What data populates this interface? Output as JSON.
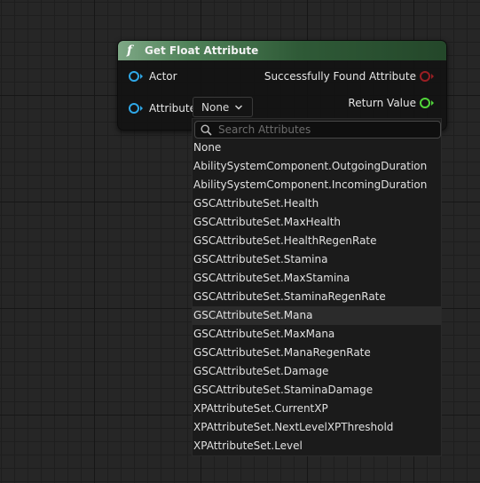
{
  "node": {
    "title": "Get Float Attribute",
    "icon": "function-icon",
    "inputs": {
      "actor_label": "Actor",
      "attribute_label": "Attribute",
      "attribute_value": "None"
    },
    "outputs": {
      "found_label": "Successfully Found Attribute",
      "return_label": "Return Value"
    }
  },
  "dropdown": {
    "search_placeholder": "Search Attributes",
    "search_value": "",
    "options": [
      "None",
      "AbilitySystemComponent.OutgoingDuration",
      "AbilitySystemComponent.IncomingDuration",
      "GSCAttributeSet.Health",
      "GSCAttributeSet.MaxHealth",
      "GSCAttributeSet.HealthRegenRate",
      "GSCAttributeSet.Stamina",
      "GSCAttributeSet.MaxStamina",
      "GSCAttributeSet.StaminaRegenRate",
      "GSCAttributeSet.Mana",
      "GSCAttributeSet.MaxMana",
      "GSCAttributeSet.ManaRegenRate",
      "GSCAttributeSet.Damage",
      "GSCAttributeSet.StaminaDamage",
      "XPAttributeSet.CurrentXP",
      "XPAttributeSet.NextLevelXPThreshold",
      "XPAttributeSet.Level"
    ],
    "hovered_option": "GSCAttributeSet.Mana"
  },
  "colors": {
    "header_start": "#7ea886",
    "header_end": "#24472a",
    "pin_object": "#2fa8e8",
    "pin_bool": "#9a1e23",
    "pin_float": "#51d63a"
  }
}
